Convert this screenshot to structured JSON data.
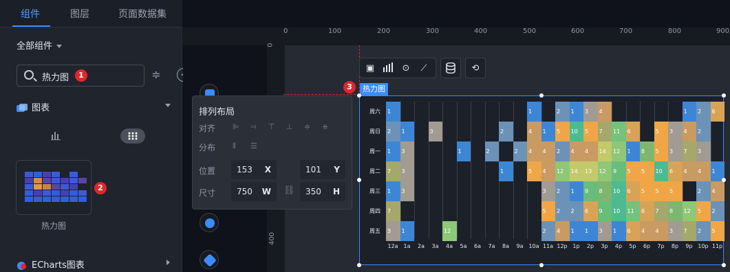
{
  "tabs": [
    "组件",
    "图层",
    "页面数据集"
  ],
  "all_components_label": "全部组件",
  "search": {
    "value": "热力图",
    "badge": "1"
  },
  "category": {
    "label": "图表"
  },
  "card": {
    "label": "热力图",
    "badge": "2"
  },
  "echarts_category": {
    "label": "ECharts图表"
  },
  "ruler": {
    "top_ticks": [
      "0",
      "100",
      "200",
      "300",
      "400",
      "500",
      "600",
      "700",
      "800",
      "900"
    ],
    "left_ticks": [
      "0",
      "400"
    ]
  },
  "popup": {
    "title": "排列布局",
    "align_label": "对齐",
    "distribute_label": "分布",
    "position_label": "位置",
    "size_label": "尺寸",
    "x_value": "153",
    "x_unit": "X",
    "y_value": "101",
    "y_unit": "Y",
    "w_value": "750",
    "w_unit": "W",
    "h_value": "350",
    "h_unit": "H"
  },
  "component_label": {
    "text": "热力图",
    "badge": "3"
  },
  "toolbar_icons": [
    "image-icon",
    "bar-chart-icon",
    "eye-icon",
    "edit-chart-icon",
    "database-icon",
    "interaction-icon"
  ],
  "colors": {
    "accent": "#3b8cff",
    "badge_red": "#e1262b"
  },
  "chart_data": {
    "type": "heatmap",
    "y_categories": [
      "周六",
      "周日",
      "周一",
      "周二",
      "周三",
      "周四",
      "周五"
    ],
    "x_categories": [
      "12a",
      "1a",
      "2a",
      "3a",
      "4a",
      "5a",
      "6a",
      "7a",
      "8a",
      "9a",
      "10a",
      "11a",
      "12p",
      "1p",
      "2p",
      "3p",
      "4p",
      "5p",
      "6p",
      "7p",
      "8p",
      "9p",
      "10p",
      "11p"
    ],
    "cells": [
      [
        "周六",
        "12a",
        1
      ],
      [
        "周六",
        "10a",
        1
      ],
      [
        "周六",
        "12p",
        2
      ],
      [
        "周六",
        "1p",
        1
      ],
      [
        "周六",
        "2p",
        3
      ],
      [
        "周六",
        "3p",
        4
      ],
      [
        "周六",
        "9p",
        1
      ],
      [
        "周六",
        "10p",
        2
      ],
      [
        "周六",
        "11p",
        2
      ],
      [
        "周六",
        "11p",
        6
      ],
      [
        "周日",
        "12a",
        2
      ],
      [
        "周日",
        "1a",
        1
      ],
      [
        "周日",
        "3a",
        3
      ],
      [
        "周日",
        "8a",
        2
      ],
      [
        "周日",
        "10a",
        4
      ],
      [
        "周日",
        "11a",
        1
      ],
      [
        "周日",
        "12p",
        5
      ],
      [
        "周日",
        "1p",
        10
      ],
      [
        "周日",
        "2p",
        5
      ],
      [
        "周日",
        "3p",
        7
      ],
      [
        "周日",
        "4p",
        11
      ],
      [
        "周日",
        "5p",
        6
      ],
      [
        "周日",
        "7p",
        5
      ],
      [
        "周日",
        "8p",
        3
      ],
      [
        "周日",
        "9p",
        4
      ],
      [
        "周日",
        "10p",
        2
      ],
      [
        "周一",
        "12a",
        1
      ],
      [
        "周一",
        "1a",
        3
      ],
      [
        "周一",
        "5a",
        1
      ],
      [
        "周一",
        "7a",
        2
      ],
      [
        "周一",
        "9a",
        2
      ],
      [
        "周一",
        "10a",
        4
      ],
      [
        "周一",
        "11a",
        4
      ],
      [
        "周一",
        "12p",
        2
      ],
      [
        "周一",
        "1p",
        4
      ],
      [
        "周一",
        "2p",
        4
      ],
      [
        "周一",
        "3p",
        14
      ],
      [
        "周一",
        "4p",
        12
      ],
      [
        "周一",
        "5p",
        1
      ],
      [
        "周一",
        "6p",
        8
      ],
      [
        "周一",
        "7p",
        5
      ],
      [
        "周一",
        "8p",
        3
      ],
      [
        "周一",
        "9p",
        7
      ],
      [
        "周一",
        "10p",
        3
      ],
      [
        "周二",
        "12a",
        7
      ],
      [
        "周二",
        "1a",
        3
      ],
      [
        "周二",
        "8a",
        1
      ],
      [
        "周二",
        "10a",
        5
      ],
      [
        "周二",
        "11a",
        4
      ],
      [
        "周二",
        "12p",
        12
      ],
      [
        "周二",
        "1p",
        14
      ],
      [
        "周二",
        "2p",
        13
      ],
      [
        "周二",
        "3p",
        12
      ],
      [
        "周二",
        "4p",
        9
      ],
      [
        "周二",
        "5p",
        5
      ],
      [
        "周二",
        "6p",
        5
      ],
      [
        "周二",
        "7p",
        10
      ],
      [
        "周二",
        "8p",
        6
      ],
      [
        "周二",
        "9p",
        4
      ],
      [
        "周二",
        "10p",
        4
      ],
      [
        "周二",
        "11p",
        1
      ],
      [
        "周三",
        "12a",
        1
      ],
      [
        "周三",
        "1a",
        3
      ],
      [
        "周三",
        "11a",
        3
      ],
      [
        "周三",
        "12p",
        2
      ],
      [
        "周三",
        "1p",
        1
      ],
      [
        "周三",
        "2p",
        9
      ],
      [
        "周三",
        "3p",
        8
      ],
      [
        "周三",
        "4p",
        10
      ],
      [
        "周三",
        "5p",
        6
      ],
      [
        "周三",
        "6p",
        5
      ],
      [
        "周三",
        "7p",
        5
      ],
      [
        "周三",
        "8p",
        5
      ],
      [
        "周三",
        "10p",
        2
      ],
      [
        "周三",
        "11p",
        4
      ],
      [
        "周四",
        "12a",
        7
      ],
      [
        "周四",
        "11a",
        5
      ],
      [
        "周四",
        "12p",
        2
      ],
      [
        "周四",
        "1p",
        2
      ],
      [
        "周四",
        "2p",
        6
      ],
      [
        "周四",
        "3p",
        9
      ],
      [
        "周四",
        "4p",
        10
      ],
      [
        "周四",
        "5p",
        11
      ],
      [
        "周四",
        "6p",
        6
      ],
      [
        "周四",
        "7p",
        7
      ],
      [
        "周四",
        "8p",
        8
      ],
      [
        "周四",
        "9p",
        12
      ],
      [
        "周四",
        "10p",
        5
      ],
      [
        "周四",
        "11p",
        5
      ],
      [
        "周四",
        "11p",
        7
      ],
      [
        "周四",
        "11p",
        2
      ],
      [
        "周五",
        "12a",
        3
      ],
      [
        "周五",
        "1a",
        1
      ],
      [
        "周五",
        "4a",
        12
      ],
      [
        "周五",
        "11a",
        2
      ],
      [
        "周五",
        "12p",
        4
      ],
      [
        "周五",
        "1p",
        1
      ],
      [
        "周五",
        "2p",
        1
      ],
      [
        "周五",
        "3p",
        3
      ],
      [
        "周五",
        "4p",
        1
      ],
      [
        "周五",
        "5p",
        6
      ],
      [
        "周五",
        "6p",
        4
      ],
      [
        "周五",
        "7p",
        4
      ],
      [
        "周五",
        "8p",
        3
      ],
      [
        "周五",
        "9p",
        7
      ],
      [
        "周五",
        "10p",
        2
      ],
      [
        "周五",
        "11p",
        5
      ]
    ]
  }
}
